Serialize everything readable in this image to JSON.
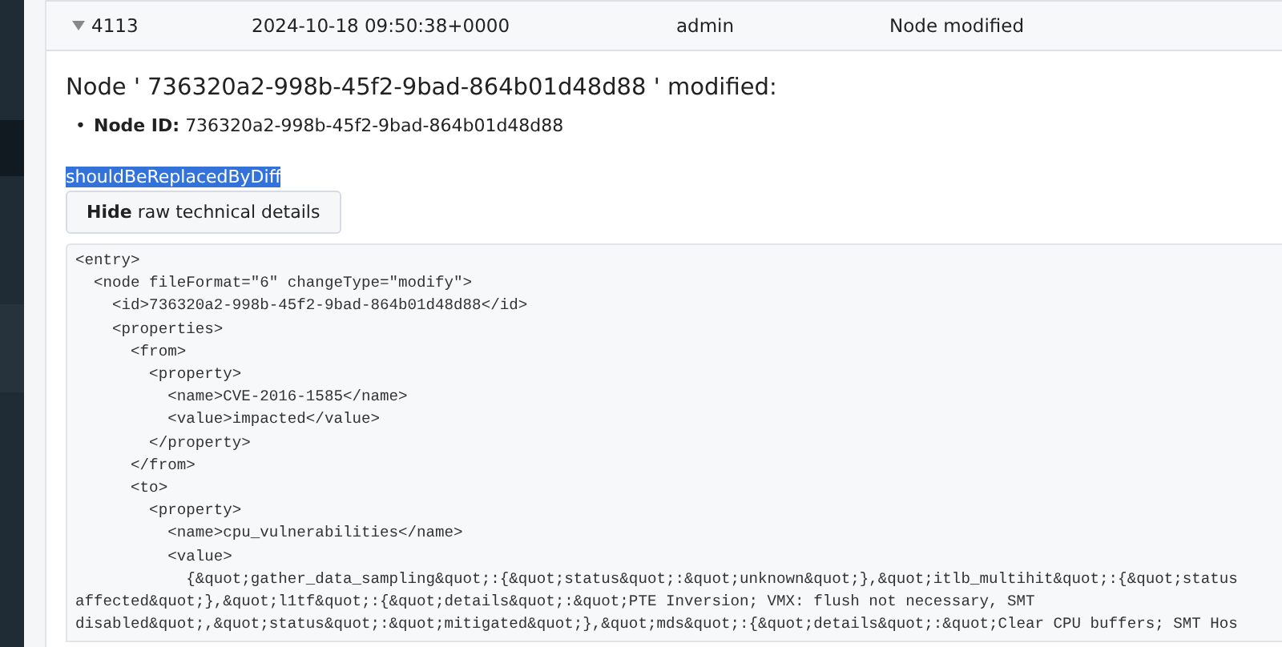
{
  "event_row": {
    "expanded": true,
    "id": "4113",
    "time": "2024-10-18 09:50:38+0000",
    "user": "admin",
    "event": "Node modified"
  },
  "details": {
    "heading": "Node ' 736320a2-998b-45f2-9bad-864b01d48d88 ' modified:",
    "fields": [
      {
        "marker": "•",
        "label": "Node ID:",
        "value": "736320a2-998b-45f2-9bad-864b01d48d88"
      }
    ],
    "selected_text": {
      "text": "shouldBeReplacedByDiff",
      "selected": true
    },
    "toggle_button": {
      "action": "Hide",
      "label": "raw technical details"
    },
    "raw_lines": [
      "<entry>",
      "  <node fileFormat=\"6\" changeType=\"modify\">",
      "    <id>736320a2-998b-45f2-9bad-864b01d48d88</id>",
      "    <properties>",
      "      <from>",
      "        <property>",
      "          <name>CVE-2016-1585</name>",
      "          <value>impacted</value>",
      "        </property>",
      "      </from>",
      "      <to>",
      "        <property>",
      "          <name>cpu_vulnerabilities</name>",
      "          <value>",
      "            {&quot;gather_data_sampling&quot;:{&quot;status&quot;:&quot;unknown&quot;},&quot;itlb_multihit&quot;:{&quot;status",
      "affected&quot;},&quot;l1tf&quot;:{&quot;details&quot;:&quot;PTE Inversion; VMX: flush not necessary, SMT",
      "disabled&quot;,&quot;status&quot;:&quot;mitigated&quot;},&quot;mds&quot;:{&quot;details&quot;:&quot;Clear CPU buffers; SMT Hos"
    ]
  }
}
